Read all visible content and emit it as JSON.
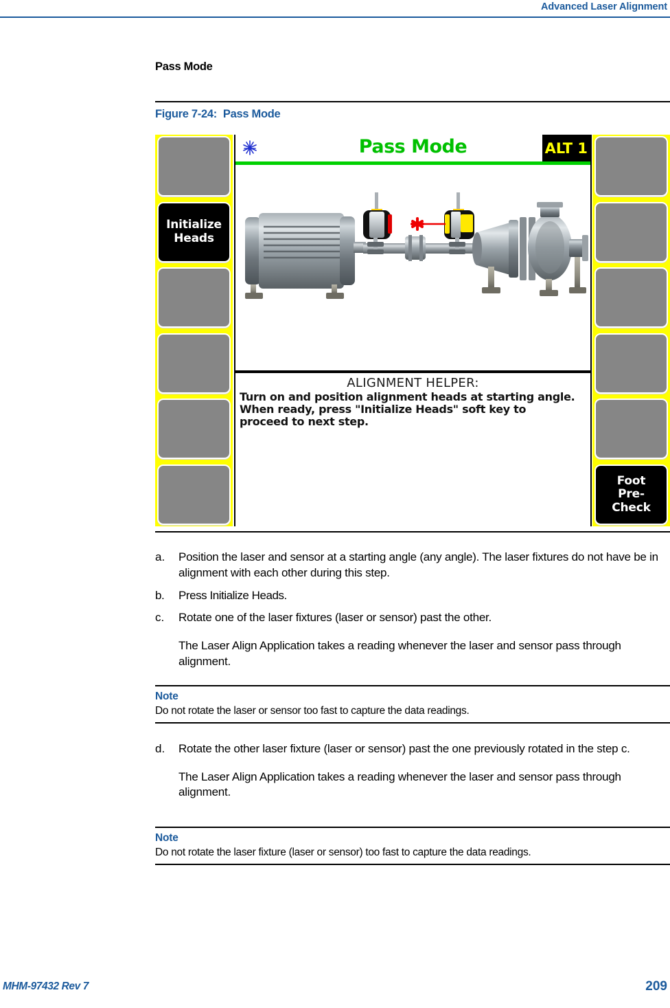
{
  "header": {
    "running_title": "Advanced Laser Alignment"
  },
  "section": {
    "heading": "Pass Mode"
  },
  "figure": {
    "number": "Figure 7-24:",
    "title": "Pass Mode"
  },
  "device_screen": {
    "title": "Pass Mode",
    "laser_icon": "laser-burst-icon",
    "alt_badge": "ALT 1",
    "colors": {
      "title_green": "#00c000",
      "bezel_yellow": "#ffff00",
      "softkey_gray": "#868686",
      "softkey_active": "#000000",
      "badge_yellow": "#ffff00",
      "laser_red": "#ee0000"
    },
    "left_softkeys": [
      {
        "label": "",
        "active": false
      },
      {
        "label": "Initialize\nHeads",
        "active": true
      },
      {
        "label": "",
        "active": false
      },
      {
        "label": "",
        "active": false
      },
      {
        "label": "",
        "active": false
      },
      {
        "label": "",
        "active": false
      }
    ],
    "right_softkeys": [
      {
        "label": "",
        "active": false
      },
      {
        "label": "",
        "active": false
      },
      {
        "label": "",
        "active": false
      },
      {
        "label": "",
        "active": false
      },
      {
        "label": "",
        "active": false
      },
      {
        "label": "Foot\nPre-\nCheck",
        "active": true
      }
    ],
    "helper": {
      "title": "ALIGNMENT HELPER:",
      "line1": "Turn on and position alignment heads at starting angle.",
      "line2": "When ready, press \"Initialize Heads\" soft key to",
      "line3": "proceed to next step."
    },
    "illustration": {
      "description": "motor-coupling-pump-assembly-with-laser-heads",
      "left_head": "laser-head-red-face",
      "right_head": "sensor-head-yellow-face",
      "beam": "laser-beam-red"
    }
  },
  "steps": [
    {
      "marker": "a.",
      "text": "Position the laser and sensor at a starting angle (any angle). The laser fixtures do not have be in alignment with each other during this step."
    },
    {
      "marker": "b.",
      "text": "Press Initialize Heads."
    },
    {
      "marker": "c.",
      "text": "Rotate one of the laser fixtures (laser or sensor) past the other."
    }
  ],
  "paragraph_after_c": "The Laser Align Application takes a reading whenever the laser and sensor pass through alignment.",
  "note1": {
    "label": "Note",
    "text": "Do not rotate the laser or sensor too fast to capture the data readings."
  },
  "step_d": {
    "marker": "d.",
    "text": "Rotate the other laser fixture (laser or sensor) past the one previously rotated in the step c."
  },
  "paragraph_after_d": "The Laser Align Application takes a reading whenever the laser and sensor pass through alignment.",
  "note2": {
    "label": "Note",
    "text": "Do not rotate the laser fixture (laser or sensor) too fast to capture the data readings."
  },
  "footer": {
    "document_id": "MHM-97432 Rev 7",
    "page_number": "209"
  }
}
